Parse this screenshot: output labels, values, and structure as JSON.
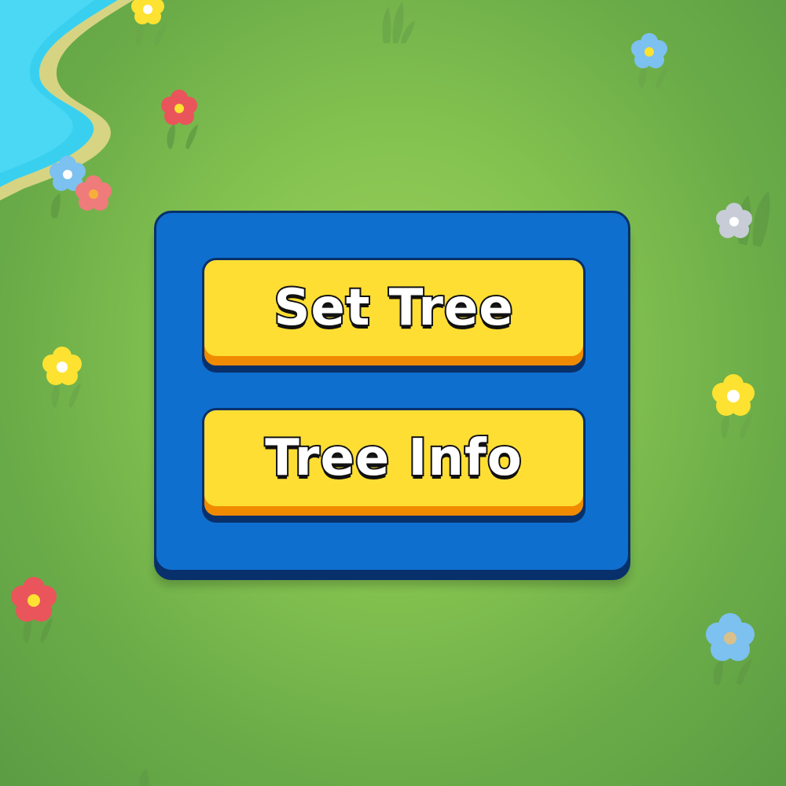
{
  "menu": {
    "buttons": [
      {
        "label": "Set Tree"
      },
      {
        "label": "Tree Info"
      }
    ]
  },
  "colors": {
    "grass": "#85c350",
    "water": "#39d0f0",
    "sand": "#e2d88a",
    "panel": "#0f6fcf",
    "panel_outline": "#08306b",
    "button": "#ffde33",
    "button_shadow": "#f08a00",
    "label_text": "#ffffff",
    "label_outline": "#111111"
  },
  "decorations": {
    "flowers": [
      {
        "name": "yellow-flower",
        "color": "#fde232"
      },
      {
        "name": "blue-flower",
        "color": "#7cc1ef"
      },
      {
        "name": "red-flower",
        "color": "#e9555a"
      },
      {
        "name": "pink-flower",
        "color": "#ef7b7b"
      },
      {
        "name": "gray-flower",
        "color": "#c7ccd6"
      }
    ]
  }
}
